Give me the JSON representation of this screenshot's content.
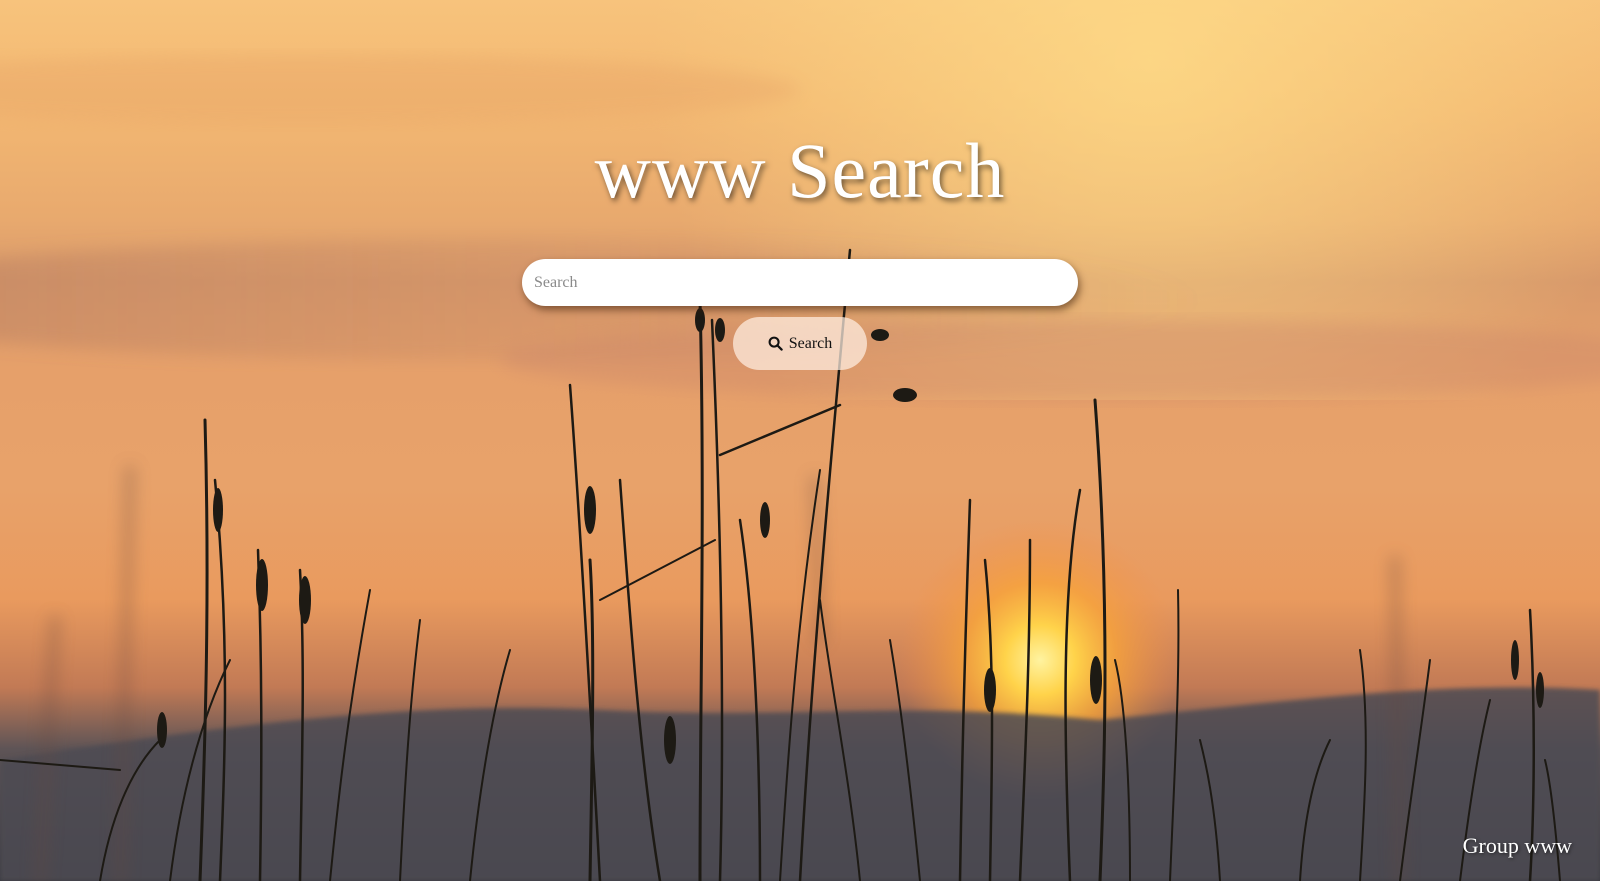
{
  "page": {
    "title": "www Search"
  },
  "search": {
    "placeholder": "Search",
    "value": "",
    "button_label": "Search",
    "button_icon": "search-icon"
  },
  "footer": {
    "text": "Group www"
  },
  "colors": {
    "sky_top": "#f6c27a",
    "sky_mid": "#e9a56a",
    "sun": "#ffd34a",
    "grass": "#1d1a14",
    "hills": "#4a4a52"
  }
}
